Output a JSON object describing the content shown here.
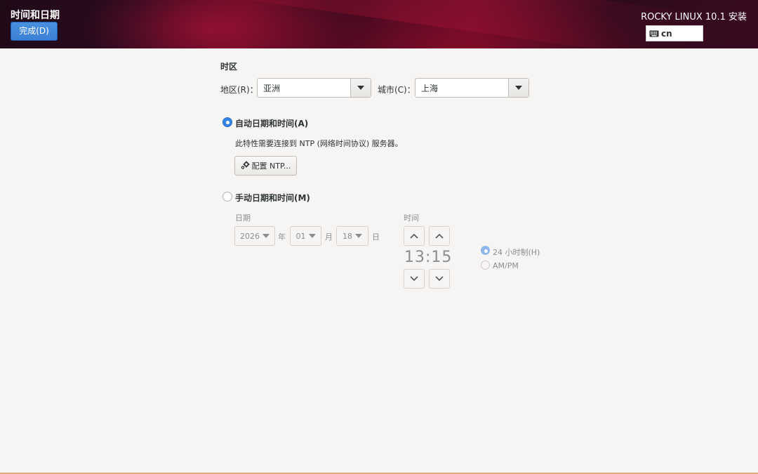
{
  "header": {
    "title": "时间和日期",
    "done_label": "完成(D)",
    "product": "ROCKY LINUX 10.1 安装",
    "keyboard_layout": "cn"
  },
  "timezone": {
    "section_title": "时区",
    "region_label": "地区(R)：",
    "region_value": "亚洲",
    "city_label": "城市(C)：",
    "city_value": "上海"
  },
  "auto": {
    "label": "自动日期和时间(A)",
    "selected": true,
    "description": "此特性需要连接到 NTP (网络时间协议) 服务器。",
    "ntp_button_label": "配置 NTP..."
  },
  "manual": {
    "label": "手动日期和时间(M)",
    "selected": false,
    "date_label": "日期",
    "year": "2026",
    "year_unit": "年",
    "month": "01",
    "month_unit": "月",
    "day": "18",
    "day_unit": "日",
    "time_label": "时间",
    "hour": "13",
    "minute": "15",
    "format_24h": "24 小时制(H)",
    "format_ampm": "AM/PM",
    "format_selected": "24h"
  },
  "colors": {
    "accent": "#3584e4",
    "header_bg": "#3a0b20",
    "footer_line": "#e8a87c"
  }
}
